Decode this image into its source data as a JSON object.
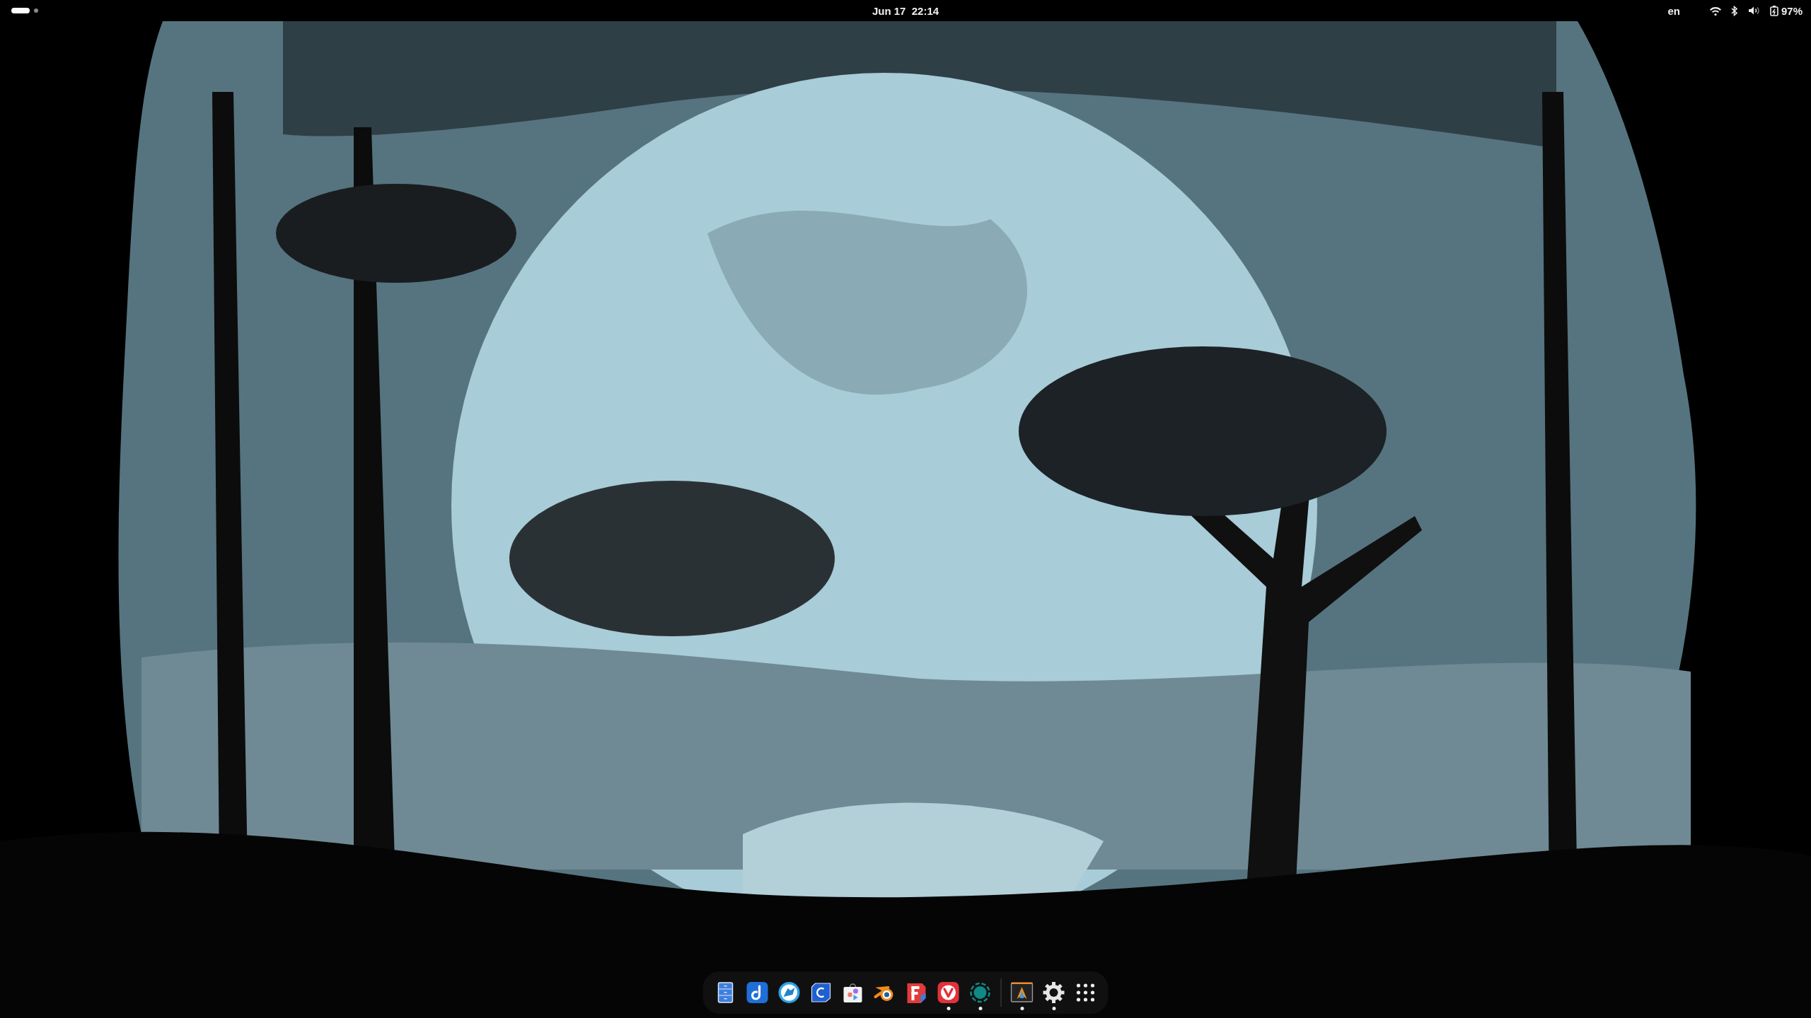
{
  "top_bar": {
    "workspaces": [
      {
        "selected": true
      },
      {
        "selected": false
      }
    ],
    "clock": "Jun 17  22:14",
    "keyboard_layout": "en",
    "battery": "97%"
  },
  "dock": {
    "favorites": [
      {
        "kind": "cabinet",
        "running": false
      },
      {
        "kind": "note",
        "running": false
      },
      {
        "kind": "wolf",
        "running": false
      },
      {
        "kind": "hexcard",
        "running": false
      },
      {
        "kind": "bag",
        "running": false
      },
      {
        "kind": "ring",
        "running": false
      },
      {
        "kind": "blocks",
        "running": false
      },
      {
        "kind": "vmark",
        "running": true
      },
      {
        "kind": "dashcircle",
        "running": true
      }
    ],
    "others": [
      {
        "kind": "terminal",
        "running": true
      },
      {
        "kind": "gear",
        "running": true
      }
    ],
    "app_grid": {
      "kind": "grid"
    }
  }
}
